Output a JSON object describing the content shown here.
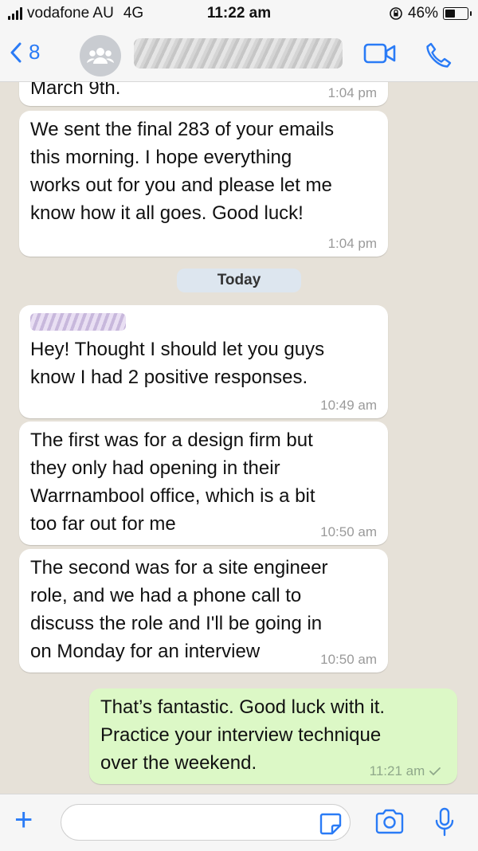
{
  "status_bar": {
    "carrier": "vodafone AU",
    "network": "4G",
    "time": "11:22 am",
    "battery": "46%"
  },
  "header": {
    "back_count": "8",
    "icons": [
      "back-chevron-icon",
      "group-avatar-icon",
      "video-call-icon",
      "phone-call-icon"
    ]
  },
  "chat": {
    "messages": [
      {
        "direction": "incoming",
        "text": "March 9th.",
        "time": "1:04 pm"
      },
      {
        "direction": "incoming",
        "text": "We sent the final 283 of your emails\nthis morning. I hope everything\nworks out for you and please let me\nknow how it all goes. Good luck!",
        "time": "1:04 pm"
      },
      {
        "direction": "incoming",
        "text": "Hey! Thought I should let you guys\nknow I had 2 positive responses.",
        "time": "10:49 am"
      },
      {
        "direction": "incoming",
        "text": "The first was for a design firm but\nthey only had opening in their\nWarrnambool office, which is a bit\ntoo far out for me",
        "time": "10:50 am"
      },
      {
        "direction": "incoming",
        "text": "The second was for a site engineer\nrole, and we had a phone call to\ndiscuss the role and I'll be going in\non Monday for an interview",
        "time": "10:50 am"
      },
      {
        "direction": "outgoing",
        "text": "That’s fantastic. Good luck with it.\nPractice your interview technique\nover the weekend.",
        "time": "11:21 am"
      }
    ],
    "day_separator": "Today"
  },
  "composer": {
    "input_value": "",
    "icons": [
      "plus-icon",
      "sticker-icon",
      "camera-icon",
      "microphone-icon"
    ]
  },
  "colors": {
    "accent": "#2a7bf6",
    "outgoing_bubble": "#dcf8c6",
    "incoming_bubble": "#ffffff",
    "chat_background": "#e6e1d8"
  }
}
